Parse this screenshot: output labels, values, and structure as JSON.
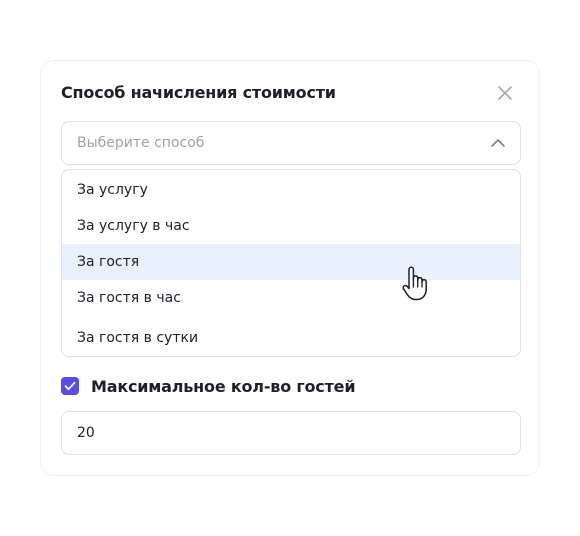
{
  "dialog": {
    "title": "Способ начисления стоимости",
    "close_icon": "close-icon"
  },
  "select": {
    "placeholder": "Выберите способ",
    "state": "open",
    "chevron_icon": "chevron-up-icon"
  },
  "dropdown": {
    "options": [
      {
        "label": "За услугу"
      },
      {
        "label": "За услугу в час"
      },
      {
        "label": "За гостя"
      },
      {
        "label": "За гостя в час"
      },
      {
        "label": "За гостя в сутки"
      }
    ],
    "hovered_index": 2
  },
  "max_guests": {
    "checked": true,
    "label": "Максимальное кол-во гостей",
    "value": "20"
  },
  "colors": {
    "accent": "#5a4de6",
    "hover_bg": "#e9f0fe",
    "border": "#dfe1e6",
    "text": "#1d1f2a",
    "placeholder": "#9ea2ab"
  },
  "cursor_icon": "hand-pointer-icon"
}
